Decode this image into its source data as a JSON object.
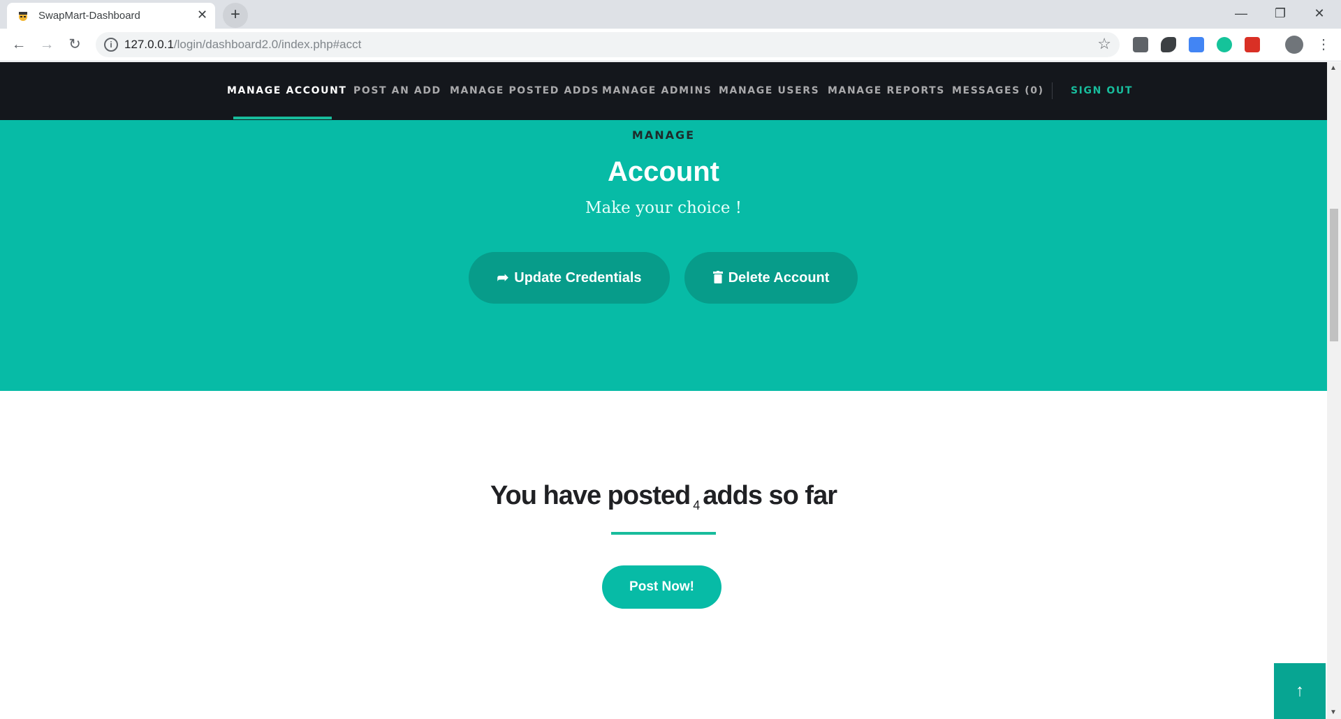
{
  "browser": {
    "tab_title": "SwapMart-Dashboard",
    "url_host": "127.0.0.1",
    "url_path": "/login/dashboard2.0/index.php#acct"
  },
  "nav": {
    "items": [
      {
        "label": "MANAGE ACCOUNT"
      },
      {
        "label": "POST AN ADD"
      },
      {
        "label": "MANAGE POSTED ADDS"
      },
      {
        "label": "MANAGE ADMINS"
      },
      {
        "label": "MANAGE USERS"
      },
      {
        "label": "MANAGE REPORTS"
      },
      {
        "label": "MESSAGES (0)"
      }
    ],
    "signout": "SIGN OUT"
  },
  "hero": {
    "eyebrow": "MANAGE",
    "title": "Account",
    "subtitle": "Make your choice !",
    "update_button": "Update Credentials",
    "delete_button": "Delete Account"
  },
  "content": {
    "title_before": "You have posted",
    "count": "4",
    "title_after": "adds so far",
    "post_button": "Post Now!"
  },
  "colors": {
    "accent": "#18bc9c",
    "hero_bg": "#07bba6",
    "navbar_bg": "#14171c"
  }
}
